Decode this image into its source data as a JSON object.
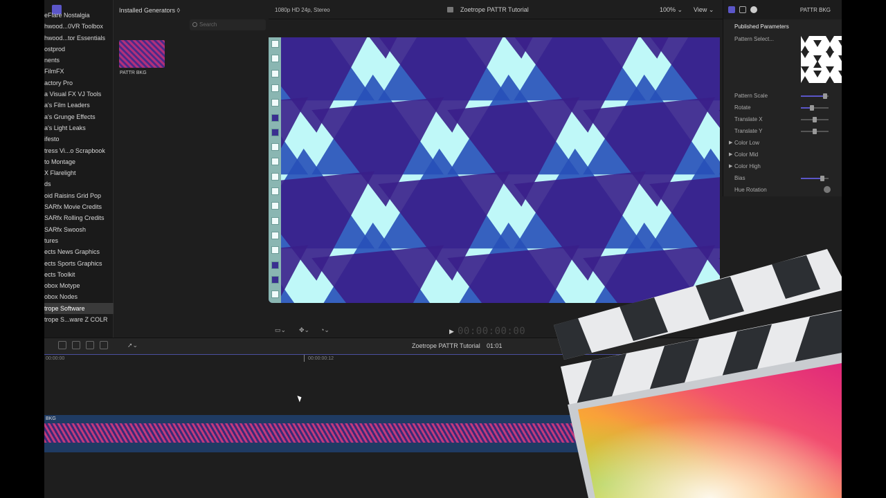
{
  "sidebar": {
    "items": [
      "eFlare Nostalgia",
      "hwood...0VR Toolbox",
      "hwood...tor Essentials",
      "ostprod",
      "nents",
      "FilmFX",
      "actory Pro",
      "a Visual FX VJ Tools",
      "a's Film Leaders",
      "a's Grunge Effects",
      "a's Light Leaks",
      "ifesto",
      "tress Vi...o Scrapbook",
      "to Montage",
      "X Flarelight",
      "ds",
      "oid Raisins Grid Pop",
      "SARfx Movie Credits",
      "SARfx Rolling Credits",
      "SARfx Swoosh",
      "tures",
      "ects News Graphics",
      "ects Sports Graphics",
      "ects Toolkit",
      "obox Motype",
      "obox Nodes",
      "trope Software",
      "trope S...ware Z COLR"
    ],
    "selected_index": 26
  },
  "browser": {
    "title": "Installed Generators ◊",
    "search_placeholder": "Search",
    "thumb_label": "PATTR BKG"
  },
  "viewer": {
    "format": "1080p HD 24p, Stereo",
    "title": "Zoetrope PATTR Tutorial",
    "zoom": "100%",
    "view": "View",
    "timecode": "00:00:00:00"
  },
  "inspector": {
    "title": "PATTR BKG",
    "section": "Published Parameters",
    "params": {
      "pattern_select": "Pattern Select...",
      "pattern_scale": "Pattern Scale",
      "rotate": "Rotate",
      "translate_x": "Translate X",
      "translate_y": "Translate Y",
      "color_low": "Color Low",
      "color_mid": "Color Mid",
      "color_high": "Color High",
      "bias": "Bias",
      "hue_rotation": "Hue Rotation"
    }
  },
  "timeline": {
    "title": "Zoetrope PATTR Tutorial",
    "duration": "01:01",
    "ruler_start": "00:00:00",
    "ruler_mark": "00:00:00:12",
    "clip_label": "BKG"
  },
  "colors": {
    "accent": "#5b56c8",
    "viewer_bg": "#bff8f8",
    "star_dark": "#3a1f8a",
    "star_blue": "#2750b8",
    "clip_bg": "#1f3b63"
  }
}
